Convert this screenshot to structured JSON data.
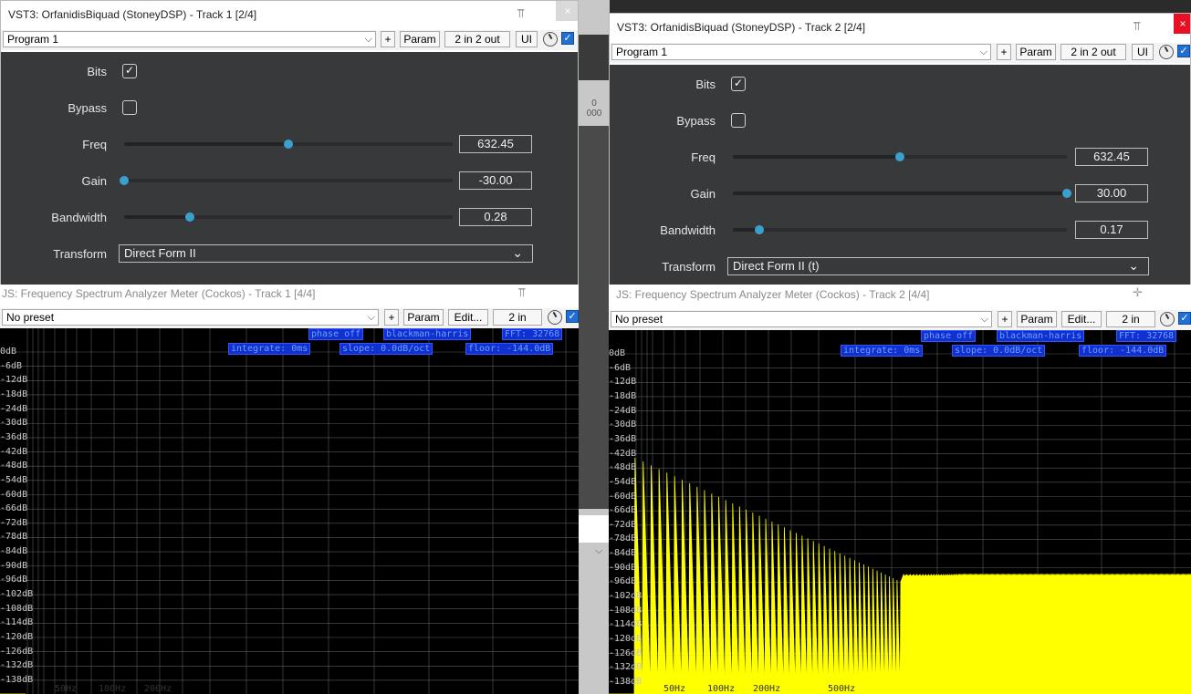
{
  "windows": [
    {
      "id": "w1",
      "title": "VST3: OrfanidisBiquad (StoneyDSP) - Track 1 [2/4]",
      "toolbar": {
        "preset": "Program 1",
        "plus": "+",
        "param": "Param",
        "io": "2 in 2 out",
        "ui": "UI"
      },
      "params": {
        "bits_label": "Bits",
        "bits_checked": true,
        "bypass_label": "Bypass",
        "bypass_checked": false,
        "freq_label": "Freq",
        "freq_value": "632.45",
        "freq_pos": 0.5,
        "gain_label": "Gain",
        "gain_value": "-30.00",
        "gain_pos": 0.0,
        "bandwidth_label": "Bandwidth",
        "bandwidth_value": "0.28",
        "bandwidth_pos": 0.2,
        "transform_label": "Transform",
        "transform_value": "Direct Form II"
      }
    },
    {
      "id": "w2",
      "title": "VST3: OrfanidisBiquad (StoneyDSP) - Track 2 [2/4]",
      "toolbar": {
        "preset": "Program 1",
        "plus": "+",
        "param": "Param",
        "io": "2 in 2 out",
        "ui": "UI"
      },
      "params": {
        "bits_label": "Bits",
        "bits_checked": true,
        "bypass_label": "Bypass",
        "bypass_checked": false,
        "freq_label": "Freq",
        "freq_value": "632.45",
        "freq_pos": 0.5,
        "gain_label": "Gain",
        "gain_value": "30.00",
        "gain_pos": 1.0,
        "bandwidth_label": "Bandwidth",
        "bandwidth_value": "0.17",
        "bandwidth_pos": 0.08,
        "transform_label": "Transform",
        "transform_value": "Direct Form II (t)"
      }
    }
  ],
  "analyzers": [
    {
      "id": "a1",
      "title": "JS: Frequency Spectrum Analyzer Meter (Cockos) - Track 1 [4/4]",
      "toolbar": {
        "preset": "No preset",
        "plus": "+",
        "param": "Param",
        "edit": "Edit...",
        "io": "2 in"
      },
      "badges": {
        "phase": "phase off",
        "window": "blackman-harris",
        "fft": "FFT: 32768",
        "integrate": "integrate: 0ms",
        "slope": "slope: 0.0dB/oct",
        "floor": "floor: -144.0dB"
      },
      "hz_labels": [
        "50Hz",
        "100Hz",
        "200Hz"
      ]
    },
    {
      "id": "a2",
      "title": "JS: Frequency Spectrum Analyzer Meter (Cockos) - Track 2 [4/4]",
      "toolbar": {
        "preset": "No preset",
        "plus": "+",
        "param": "Param",
        "edit": "Edit...",
        "io": "2 in"
      },
      "badges": {
        "phase": "phase off",
        "window": "blackman-harris",
        "fft": "FFT: 32768",
        "integrate": "integrate: 0ms",
        "slope": "slope: 0.0dB/oct",
        "floor": "floor: -144.0dB"
      },
      "hz_labels": [
        "50Hz",
        "100Hz",
        "200Hz",
        "500Hz"
      ]
    }
  ],
  "db_labels": [
    "0dB",
    "-6dB",
    "-12dB",
    "-18dB",
    "-24dB",
    "-30dB",
    "-36dB",
    "-42dB",
    "-48dB",
    "-54dB",
    "-60dB",
    "-66dB",
    "-72dB",
    "-78dB",
    "-84dB",
    "-90dB",
    "-96dB",
    "-102dB",
    "-108dB",
    "-114dB",
    "-120dB",
    "-126dB",
    "-132dB",
    "-138dB"
  ],
  "background": {
    "ruler_text": "0\n000"
  },
  "icons": {
    "pin": "pin-icon",
    "close": "close-icon",
    "check": "checkmark-icon",
    "chevron": "chevron-down-icon",
    "knob": "wet-knob-icon"
  },
  "colors": {
    "spectrum": "#ffff00",
    "badge_bg": "#1030d0",
    "plugin_bg": "#37393b",
    "slider_thumb": "#3aa0d0"
  }
}
